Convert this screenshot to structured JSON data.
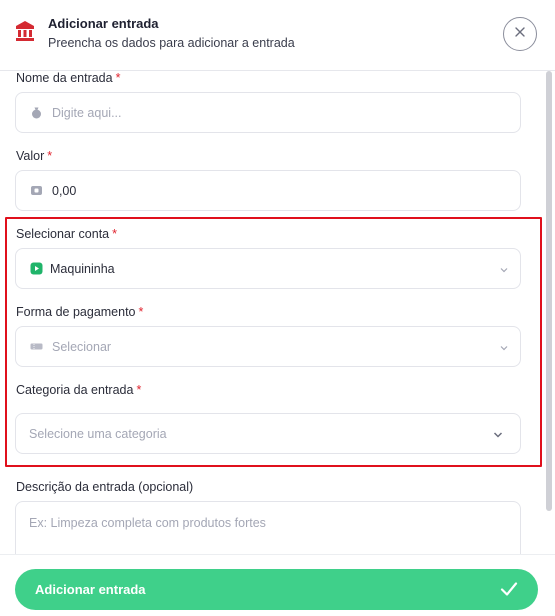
{
  "header": {
    "title": "Adicionar entrada",
    "subtitle": "Preencha os dados para adicionar a entrada",
    "icon": "bank-icon",
    "close_icon": "close-icon"
  },
  "form": {
    "required_mark": "*",
    "name": {
      "label": "Nome da entrada",
      "placeholder": "Digite aqui..."
    },
    "value": {
      "label": "Valor",
      "value": "0,00"
    },
    "account": {
      "label": "Selecionar conta",
      "value": "Maquininha"
    },
    "payment": {
      "label": "Forma de pagamento",
      "placeholder": "Selecionar"
    },
    "category": {
      "label": "Categoria da entrada",
      "placeholder": "Selecione uma categoria"
    },
    "description": {
      "label": "Descrição da entrada (opcional)",
      "placeholder": "Ex: Limpeza completa com produtos fortes"
    }
  },
  "footer": {
    "submit_label": "Adicionar entrada"
  },
  "colors": {
    "accent": "#3fd08a",
    "required": "#e0232e",
    "highlight": "#e0101c",
    "header_icon": "#d42a32",
    "account_icon": "#20b46a"
  }
}
